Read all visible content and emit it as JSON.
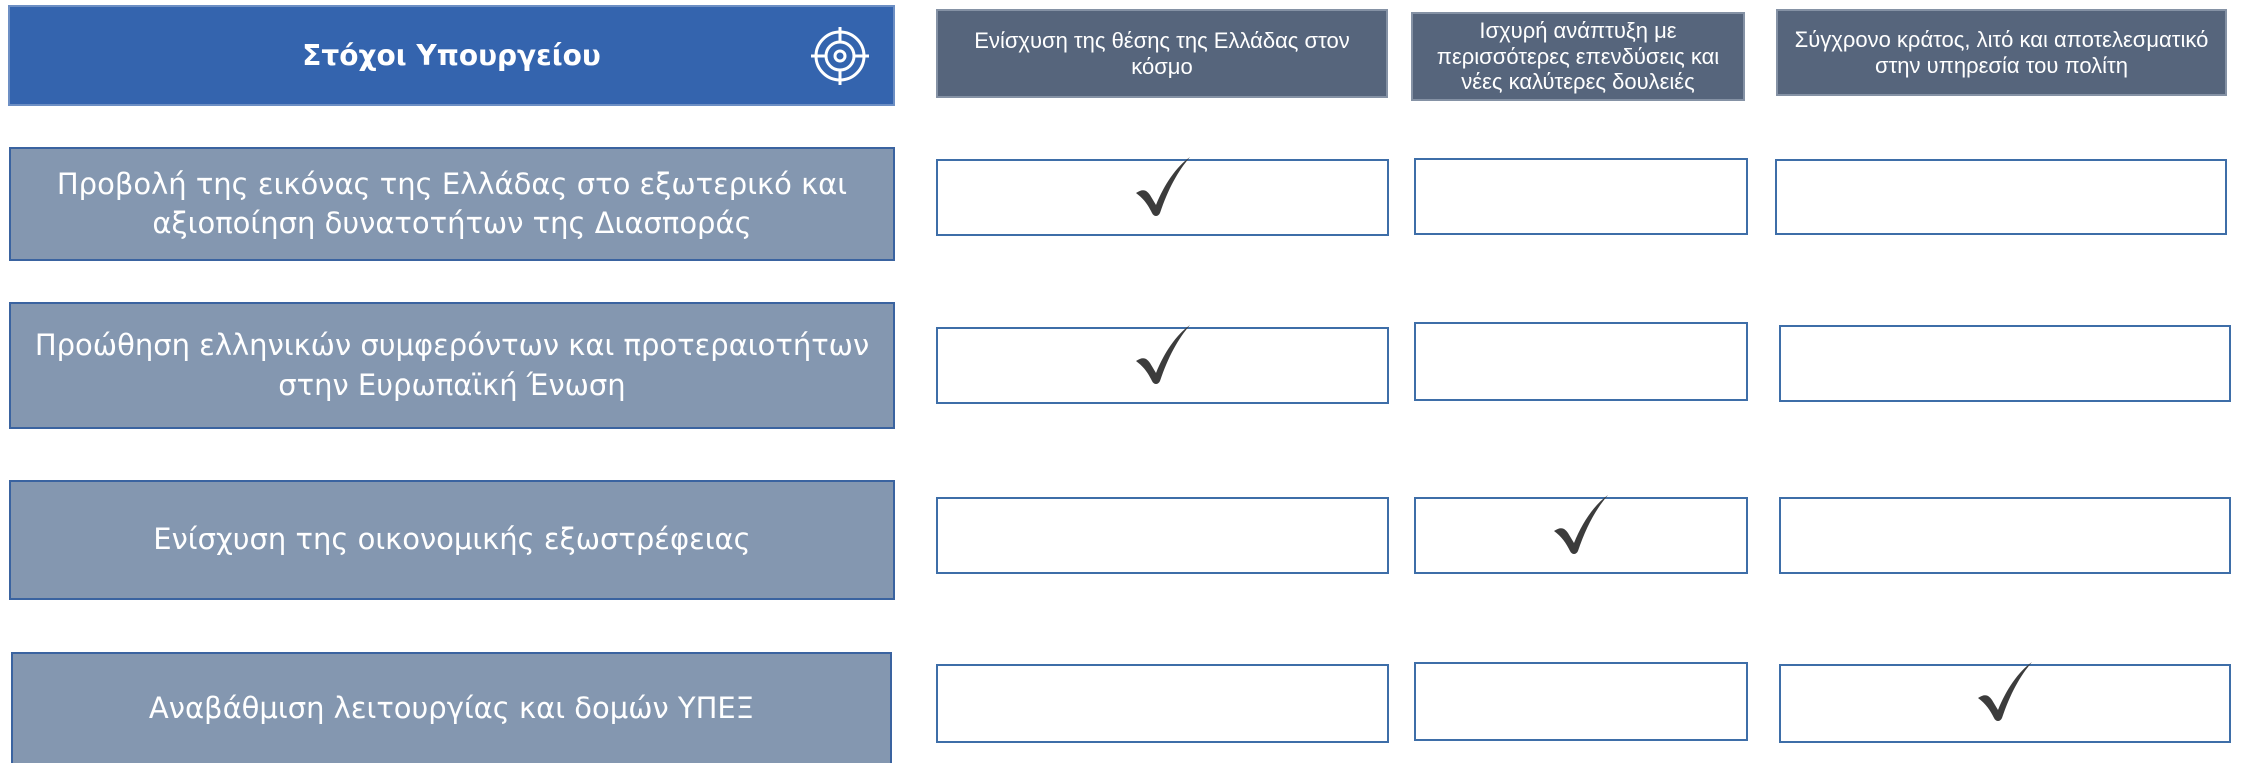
{
  "title": "Στόχοι Υπουργείου",
  "columns": [
    {
      "label": "Ενίσχυση της θέσης της Ελλάδας στον κόσμο"
    },
    {
      "label": "Ισχυρή ανάπτυξη με περισσότερες επενδύσεις και νέες καλύτερες δουλειές"
    },
    {
      "label": "Σύγχρονο κράτος, λιτό και αποτελεσματικό στην υπηρεσία του πολίτη"
    }
  ],
  "rows": [
    {
      "label": "Προβολή της εικόνας της Ελλάδας στο εξωτερικό και αξιοποίηση δυνατοτήτων της Διασποράς",
      "checks": [
        true,
        false,
        false
      ]
    },
    {
      "label": "Προώθηση ελληνικών συμφερόντων και προτεραιοτήτων στην Ευρωπαϊκή Ένωση",
      "checks": [
        true,
        false,
        false
      ]
    },
    {
      "label": "Ενίσχυση της οικονομικής εξωστρέφειας",
      "checks": [
        false,
        true,
        false
      ]
    },
    {
      "label": "Αναβάθμιση λειτουργίας και δομών ΥΠΕΞ",
      "checks": [
        false,
        false,
        true
      ]
    }
  ],
  "icons": {
    "title_icon": "target-icon",
    "check_icon": "checkmark-icon"
  },
  "colors": {
    "title_bg": "#3464ae",
    "column_header_bg": "#56657c",
    "goal_bg": "#8497b0",
    "cell_border": "#3e6ea8",
    "check": "#3c3c3c"
  }
}
